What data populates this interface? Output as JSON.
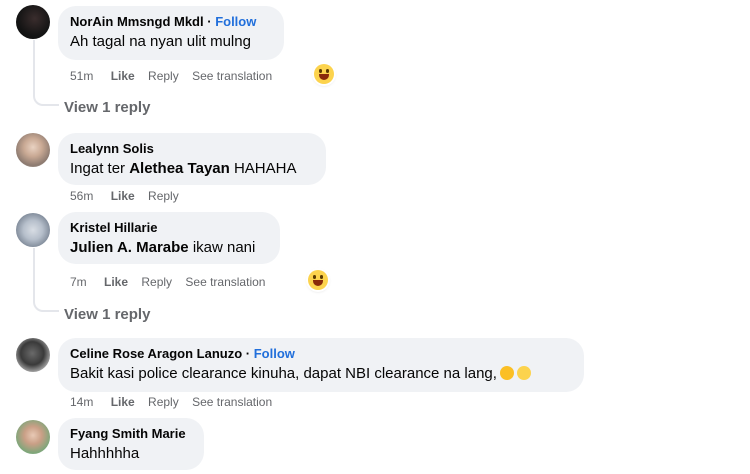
{
  "comments": [
    {
      "author": "NorAin Mmsngd Mkdl",
      "follow": "Follow",
      "text": "Ah tagal na nyan ulit mulng",
      "time": "51m",
      "actions": [
        "Like",
        "Reply",
        "See translation"
      ],
      "replies_label": "View 1 reply"
    },
    {
      "author": "Lealynn Solis",
      "text_prefix": "Ingat ter ",
      "mention": "Alethea Tayan",
      "text_suffix": " HAHAHA",
      "time": "56m",
      "actions": [
        "Like",
        "Reply"
      ]
    },
    {
      "author": "Kristel Hillarie",
      "mention": "Julien A. Marabe",
      "text_suffix": " ikaw nani",
      "time": "7m",
      "actions": [
        "Like",
        "Reply",
        "See translation"
      ],
      "replies_label": "View 1 reply"
    },
    {
      "author": "Celine Rose Aragon Lanuzo",
      "follow": "Follow",
      "text": "Bakit kasi police clearance kinuha, dapat NBI clearance na lang,",
      "time": "14m",
      "actions": [
        "Like",
        "Reply",
        "See translation"
      ]
    },
    {
      "author": "Fyang Smith Marie",
      "text": "Hahhhhha"
    }
  ],
  "icons": {
    "reaction": "laughing-reaction-icon",
    "inline_emojis": [
      "rolling-on-floor-laughing-icon",
      "crying-face-icon"
    ]
  },
  "colors": {
    "bubble": "#f0f2f5",
    "follow": "#216fdb",
    "meta": "#65676b",
    "text": "#050505"
  }
}
